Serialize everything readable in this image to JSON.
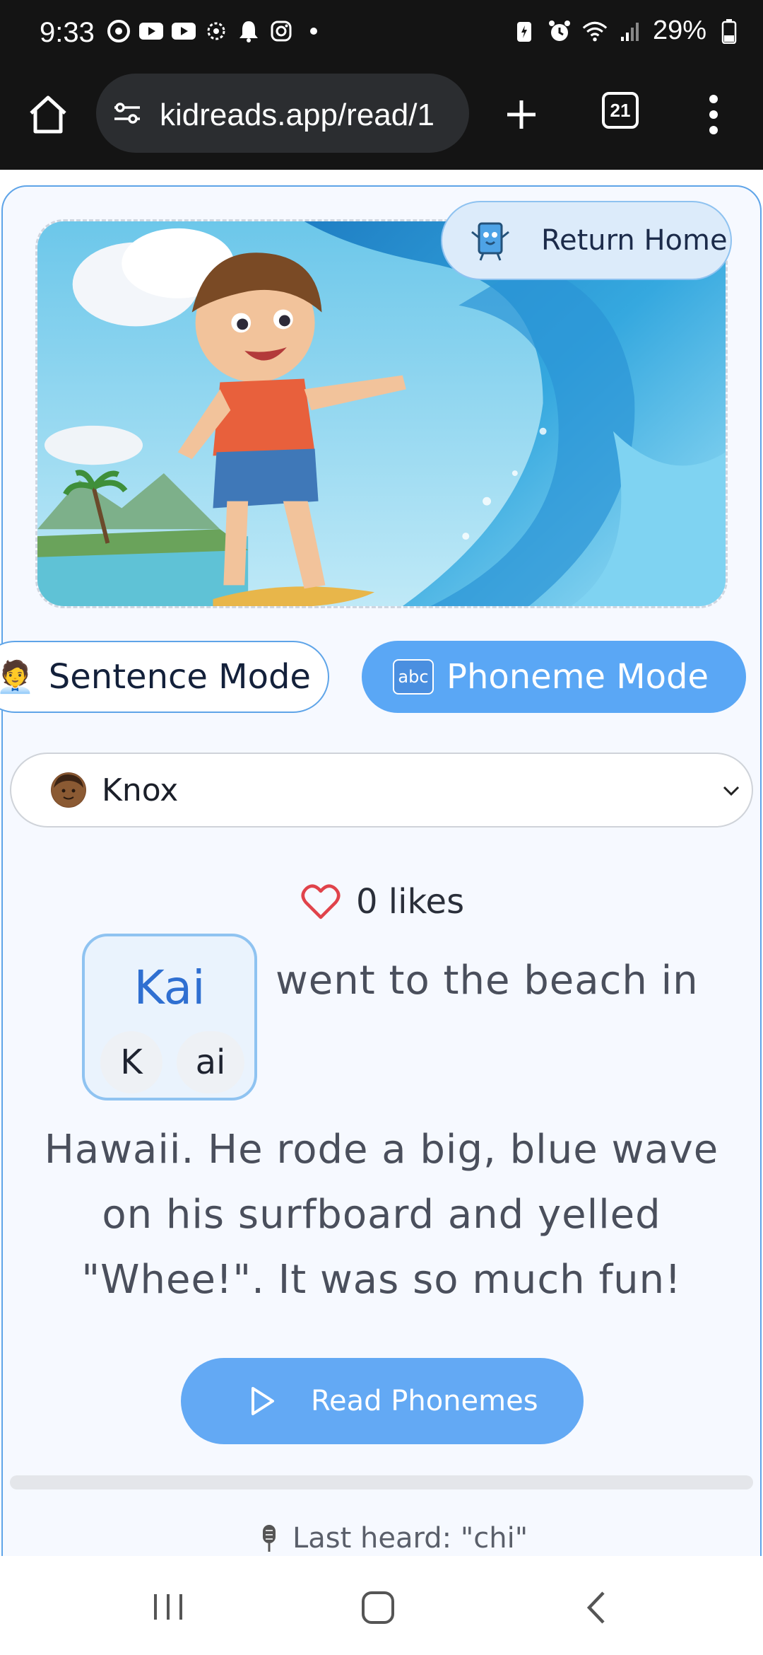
{
  "status_bar": {
    "time": "9:33",
    "battery": "29%"
  },
  "browser": {
    "url": "kidreads.app/read/1",
    "tab_count": "21"
  },
  "header": {
    "return_home_label": "Return Home"
  },
  "modes": {
    "sentence_label": "Sentence Mode",
    "sentence_emoji": "🧑‍💼",
    "phoneme_label": "Phoneme Mode",
    "phoneme_icon_text": "abc",
    "active": "phoneme"
  },
  "voice": {
    "selected": "Knox"
  },
  "likes": {
    "label": "0 likes"
  },
  "story": {
    "highlight_word": "Kai",
    "phonemes": [
      "K",
      "ai"
    ],
    "line1": "went to the beach in",
    "rest": "Hawaii. He rode a big, blue wave on his surfboard and yelled \"Whee!\". It was so much fun!"
  },
  "controls": {
    "read_button_label": "Read Phonemes",
    "progress_fraction": 0
  },
  "recognition": {
    "last_heard": "Last heard: \"chi\""
  },
  "colors": {
    "accent": "#5aa7f5",
    "highlight_word": "#2f6fd1",
    "heart": "#e0434b"
  }
}
